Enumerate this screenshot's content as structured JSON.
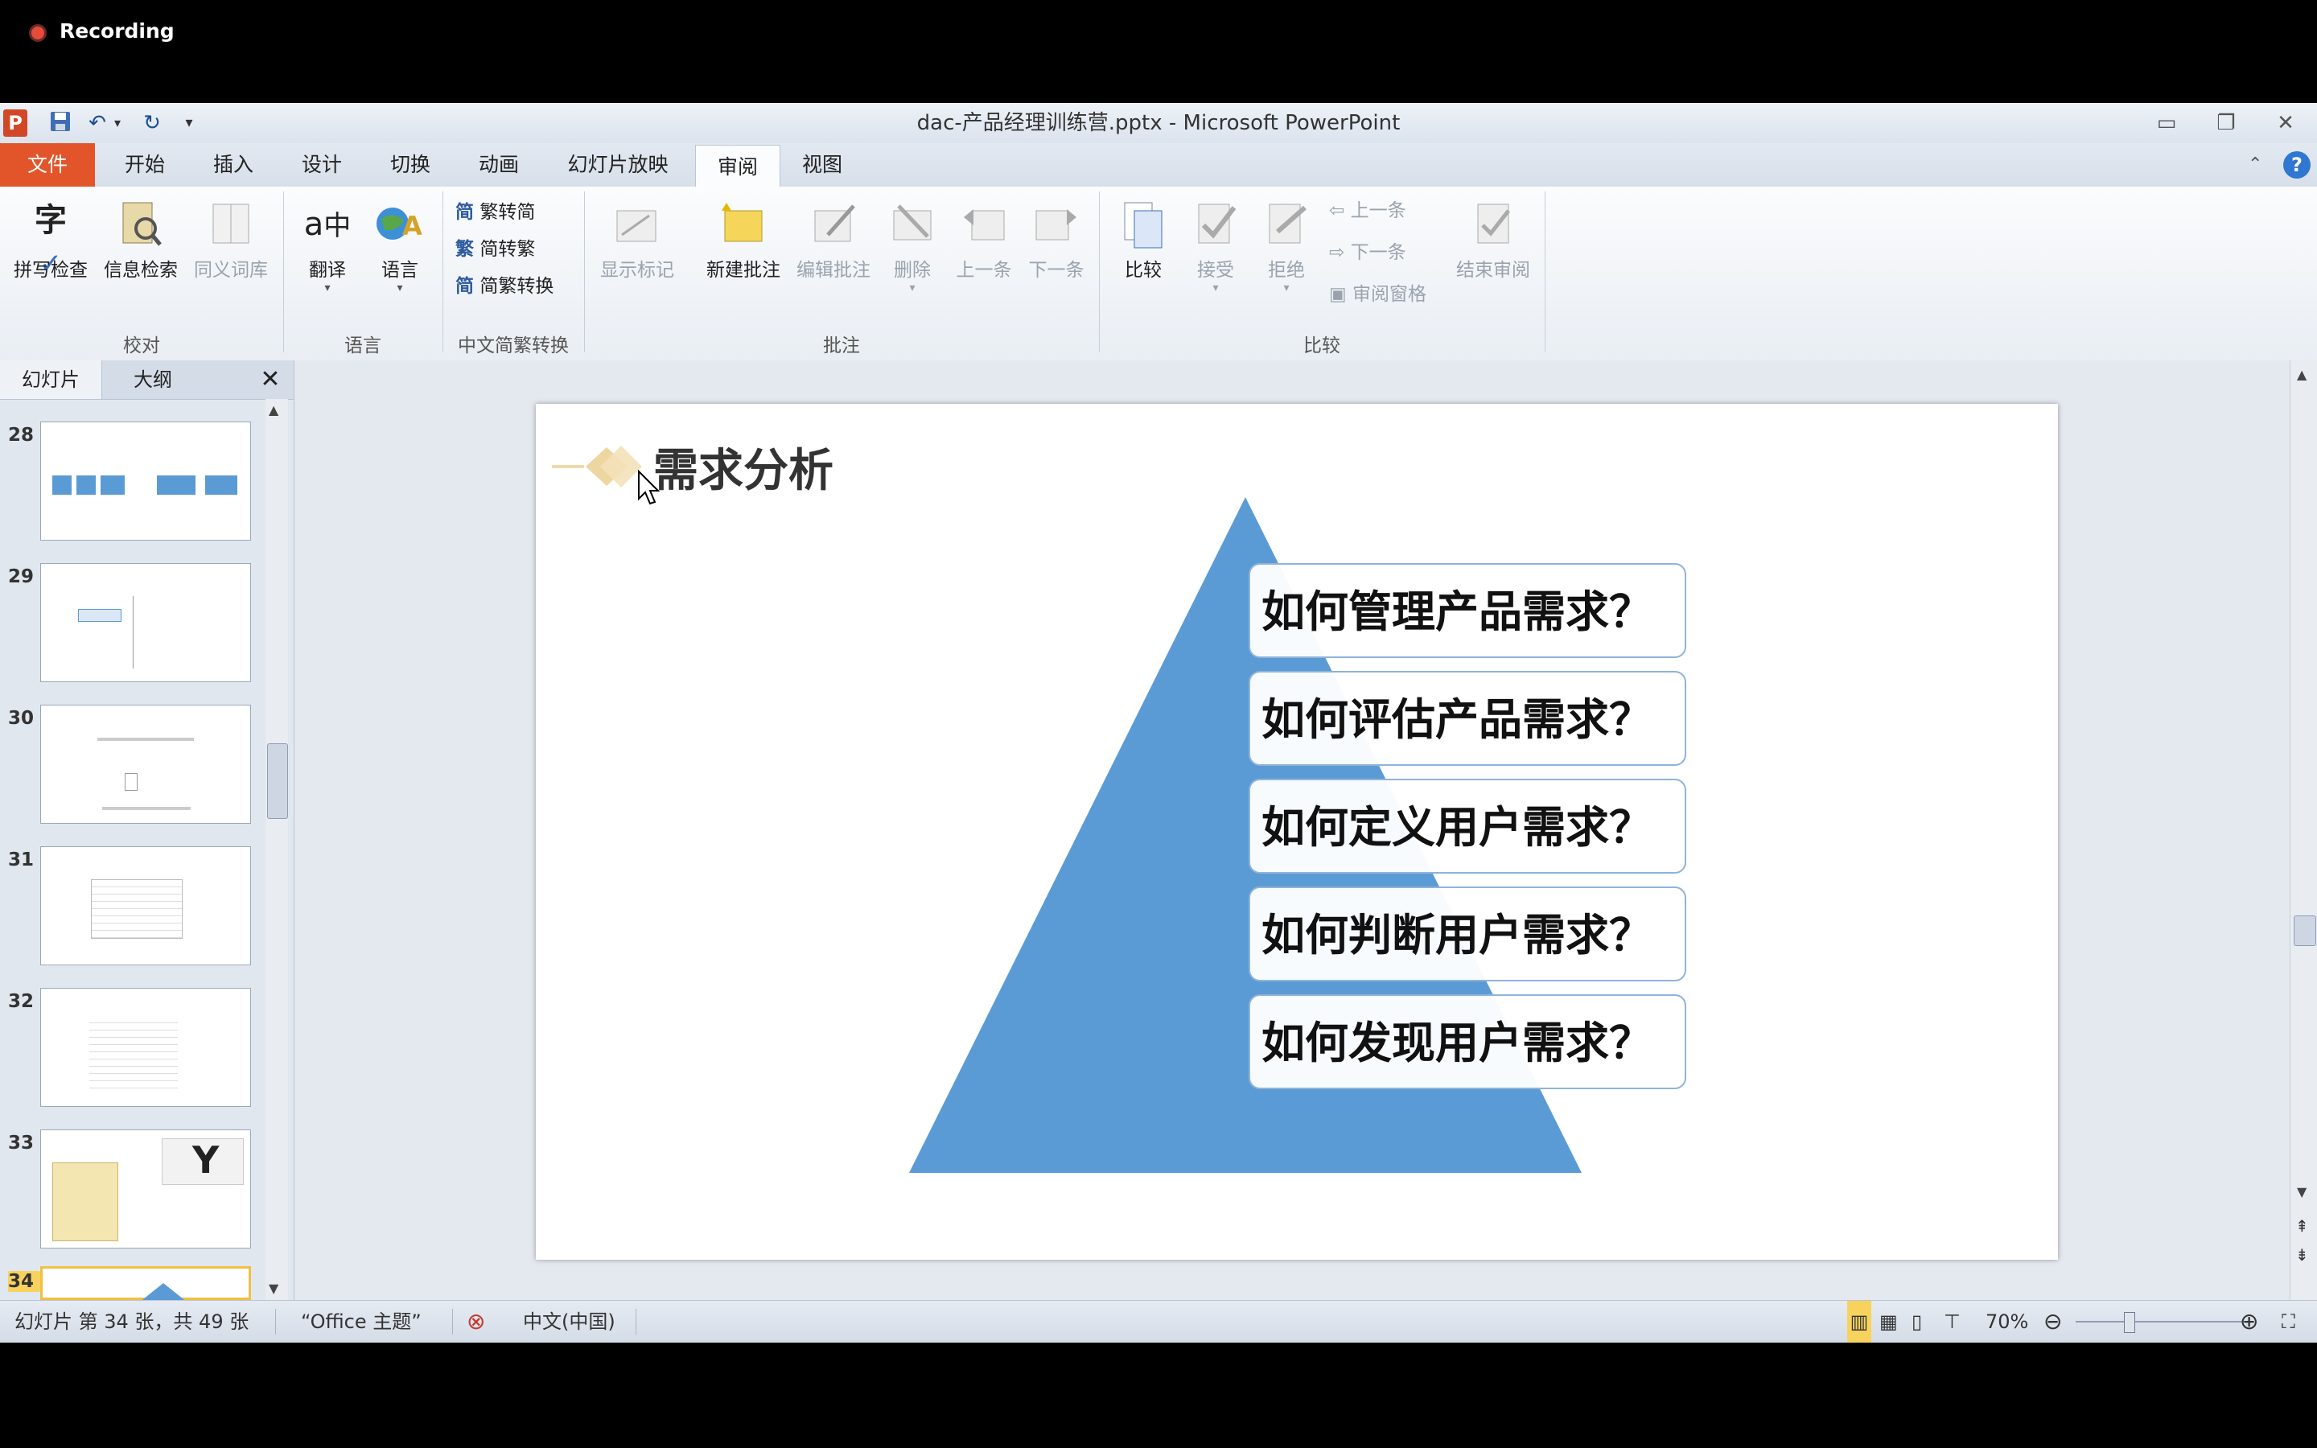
{
  "recording": {
    "label": "Recording"
  },
  "window": {
    "title": "dac-产品经理训练营.pptx - Microsoft PowerPoint",
    "quick_access": [
      "save-icon",
      "undo-icon",
      "redo-icon",
      "customize-icon"
    ]
  },
  "tabs": [
    "文件",
    "开始",
    "插入",
    "设计",
    "切换",
    "动画",
    "幻灯片放映",
    "审阅",
    "视图"
  ],
  "active_tab": "审阅",
  "ribbon": {
    "groups": {
      "proofing": {
        "label": "校对",
        "buttons": [
          "拼写检查",
          "信息检索",
          "同义词库"
        ]
      },
      "language": {
        "label": "语言",
        "buttons": [
          "翻译",
          "语言"
        ]
      },
      "chinese": {
        "label": "中文简繁转换",
        "buttons": [
          "繁转简",
          "简转繁",
          "简繁转换"
        ]
      },
      "comments": {
        "label": "批注",
        "buttons": [
          "显示标记",
          "新建批注",
          "编辑批注",
          "删除",
          "上一条",
          "下一条"
        ]
      },
      "compare": {
        "label": "比较",
        "buttons": [
          "比较",
          "接受",
          "拒绝",
          "上一条",
          "下一条",
          "审阅窗格",
          "结束审阅"
        ]
      }
    }
  },
  "left_pane": {
    "tabs": [
      "幻灯片",
      "大纲"
    ],
    "slide_numbers": [
      "28",
      "29",
      "30",
      "31",
      "32",
      "33",
      "34"
    ],
    "selected": "34"
  },
  "slide": {
    "title": "需求分析",
    "questions": [
      "如何管理产品需求？",
      "如何评估产品需求？",
      "如何定义用户需求？",
      "如何判断用户需求？",
      "如何发现用户需求？"
    ],
    "colors": {
      "triangle": "#5b9bd5",
      "diamond": "#f0d9a8"
    }
  },
  "status": {
    "slide_info": "幻灯片 第 34 张，共 49 张",
    "theme": "“Office 主题”",
    "language": "中文(中国)",
    "zoom": "70%"
  }
}
